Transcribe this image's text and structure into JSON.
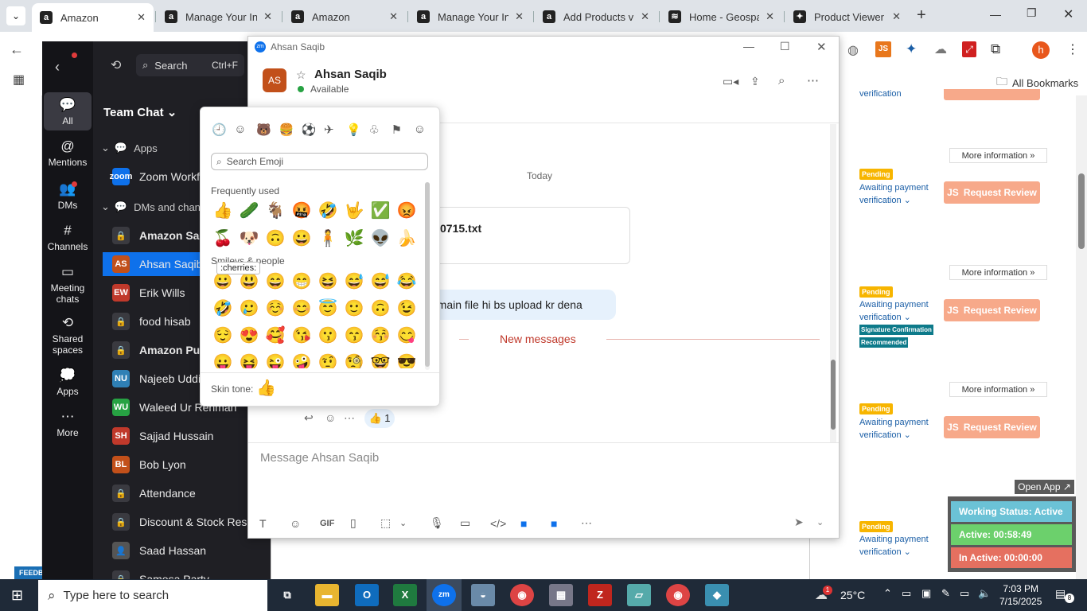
{
  "browser": {
    "tabs": [
      {
        "title": "Amazon",
        "favicon": "a"
      },
      {
        "title": "Manage Your In",
        "favicon": "a"
      },
      {
        "title": "Amazon",
        "favicon": "a"
      },
      {
        "title": "Manage Your In",
        "favicon": "a"
      },
      {
        "title": "Add Products vi",
        "favicon": "a"
      },
      {
        "title": "Home - Geospac",
        "favicon": "≋"
      },
      {
        "title": "Product Viewer",
        "favicon": "✦"
      }
    ],
    "all_bookmarks": "All Bookmarks",
    "profile_initial": "h"
  },
  "zoom": {
    "nav": {
      "search_placeholder": "Search",
      "search_shortcut": "Ctrl+F",
      "items": [
        {
          "label": "All"
        },
        {
          "label": "Mentions"
        },
        {
          "label": "DMs"
        },
        {
          "label": "Channels"
        },
        {
          "label": "Meeting chats"
        },
        {
          "label": "Shared spaces"
        },
        {
          "label": "Apps"
        },
        {
          "label": "More"
        }
      ]
    },
    "list": {
      "header": "Team Chat",
      "section_apps": "Apps",
      "section_dms": "DMs and channels",
      "items": [
        {
          "name": "Zoom Workflows",
          "avatar": "zoom",
          "color": "#0e71eb"
        },
        {
          "name": "Amazon Sales",
          "avatar": "🔒",
          "color": "#3a3a40"
        },
        {
          "name": "Ahsan Saqib",
          "avatar": "AS",
          "color": "#c2501a"
        },
        {
          "name": "Erik Wills",
          "avatar": "EW",
          "color": "#c0392b"
        },
        {
          "name": "food hisab",
          "avatar": "🔒",
          "color": "#3a3a40"
        },
        {
          "name": "Amazon Purchase",
          "avatar": "🔒",
          "color": "#3a3a40"
        },
        {
          "name": "Najeeb Uddin",
          "avatar": "NU",
          "color": "#2f80b5"
        },
        {
          "name": "Waleed Ur Rehman",
          "avatar": "WU",
          "color": "#27a243"
        },
        {
          "name": "Sajjad Hussain",
          "avatar": "SH",
          "color": "#c0392b"
        },
        {
          "name": "Bob Lyon",
          "avatar": "BL",
          "color": "#c2501a"
        },
        {
          "name": "Attendance",
          "avatar": "🔒",
          "color": "#3a3a40"
        },
        {
          "name": "Discount & Stock Reser...",
          "avatar": "🔒",
          "color": "#3a3a40"
        },
        {
          "name": "Saad Hassan",
          "avatar": "👤",
          "color": "#555"
        },
        {
          "name": "Samosa Party",
          "avatar": "🔒",
          "color": "#3a3a40"
        }
      ]
    }
  },
  "chat": {
    "window_title": "Ahsan Saqib",
    "contact_name": "Ahsan Saqib",
    "contact_initials": "AS",
    "status": "Available",
    "date_divider": "Today",
    "file_name_fragment": "0715.txt",
    "message_fragment": "e main file  hi bs upload kr dena",
    "new_messages": "New messages",
    "reaction": "👍 1",
    "input_placeholder": "Message Ahsan Saqib",
    "gif_label": "GIF"
  },
  "emoji_picker": {
    "search_placeholder": "Search Emoji",
    "frequently_used_label": "Frequently used",
    "smileys_label": "Smileys & people",
    "tooltip": ":cherries:",
    "skin_tone_label": "Skin tone:",
    "skin_tone_emoji": "👍",
    "categories": [
      "🕘",
      "☺",
      "🐻",
      "🍔",
      "⚽",
      "✈",
      "💡",
      "♧",
      "⚑",
      "☺"
    ],
    "frequent": [
      "👍",
      "🥒",
      "🐐",
      "🤬",
      "🤣",
      "🤟",
      "✅",
      "😡",
      "🍒",
      "🐶",
      "🙃",
      "😀",
      "🧍",
      "🌿",
      "👽",
      "🍌"
    ],
    "smileys": [
      "😀",
      "😃",
      "😄",
      "😁",
      "😆",
      "😅",
      "😅",
      "😂",
      "🤣",
      "🥲",
      "☺️",
      "😊",
      "😇",
      "🙂",
      "🙃",
      "😉",
      "😌",
      "😍",
      "🥰",
      "😘",
      "😗",
      "😙",
      "😚",
      "😋",
      "😛",
      "😝",
      "😜",
      "🤪",
      "🤨",
      "🧐",
      "🤓",
      "😎"
    ]
  },
  "right_page": {
    "pending": "Pending",
    "awaiting": "Awaiting payment",
    "verification": "verification",
    "request_review": "Request Review",
    "more_info": "More information »",
    "signature": "Signature Confirmation",
    "recommended": "Recommended",
    "open_app": "Open App ↗"
  },
  "tracker": {
    "working_status": "Working Status: Active",
    "active": "Active: 00:58:49",
    "inactive": "In Active: 00:00:00"
  },
  "taskbar": {
    "search_placeholder": "Type here to search",
    "temperature": "25°C",
    "time": "7:03 PM",
    "date": "7/15/2025",
    "notifications": "8",
    "weather_badge": "1"
  },
  "colors": {
    "zoom_blue": "#0e71eb",
    "new_messages_red": "#c0392b",
    "pending_yellow": "#f7b500",
    "request_review": "#f7a98a"
  }
}
